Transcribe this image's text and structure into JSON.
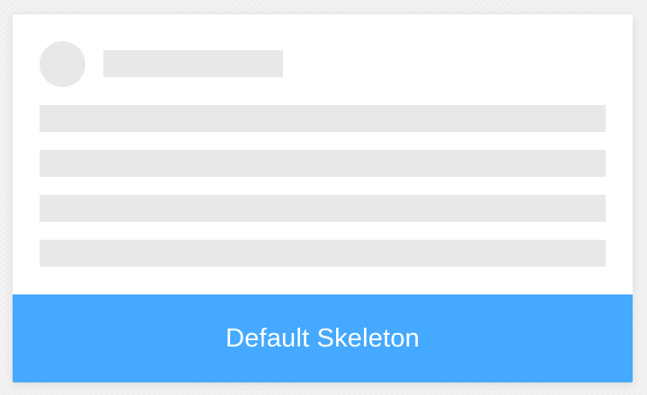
{
  "footer": {
    "label": "Default Skeleton",
    "background": "#45A9FF",
    "text_color": "#FFFFFF"
  },
  "skeleton": {
    "placeholder_color": "#E8E8EA",
    "paragraph_line_count": 4
  }
}
